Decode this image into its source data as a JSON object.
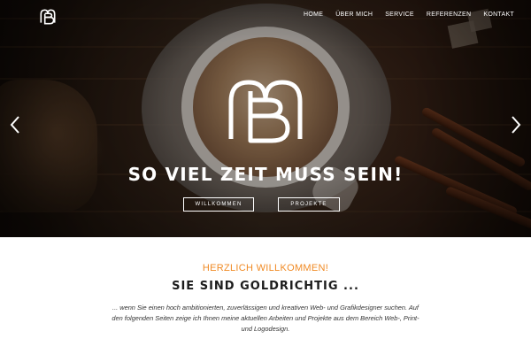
{
  "nav": {
    "items": [
      {
        "label": "HOME"
      },
      {
        "label": "ÜBER MICH"
      },
      {
        "label": "SERVICE"
      },
      {
        "label": "REFERENZEN"
      },
      {
        "label": "KONTAKT"
      }
    ]
  },
  "hero": {
    "title": "SO VIEL ZEIT MUSS SEIN!",
    "button_welcome": "WILLKOMMEN",
    "button_projects": "PROJEKTE",
    "logo_letters": "BM"
  },
  "content": {
    "welcome": "HERZLICH WILLKOMMEN!",
    "heading": "SIE SIND GOLDRICHTIG ...",
    "intro": "... wenn Sie einen hoch ambitionierten, zuverlässigen und kreativen Web- und Grafikdesigner suchen. Auf den folgenden Seiten zeige ich Ihnen meine aktuellen Arbeiten und Projekte aus dem Bereich Web-, Print- und Logodesign."
  },
  "colors": {
    "accent": "#f08a24",
    "heading": "#1c1c1c",
    "hero_text": "#ffffff"
  },
  "icons": {
    "logo": "bm-monogram-icon",
    "prev": "chevron-left-icon",
    "next": "chevron-right-icon"
  }
}
